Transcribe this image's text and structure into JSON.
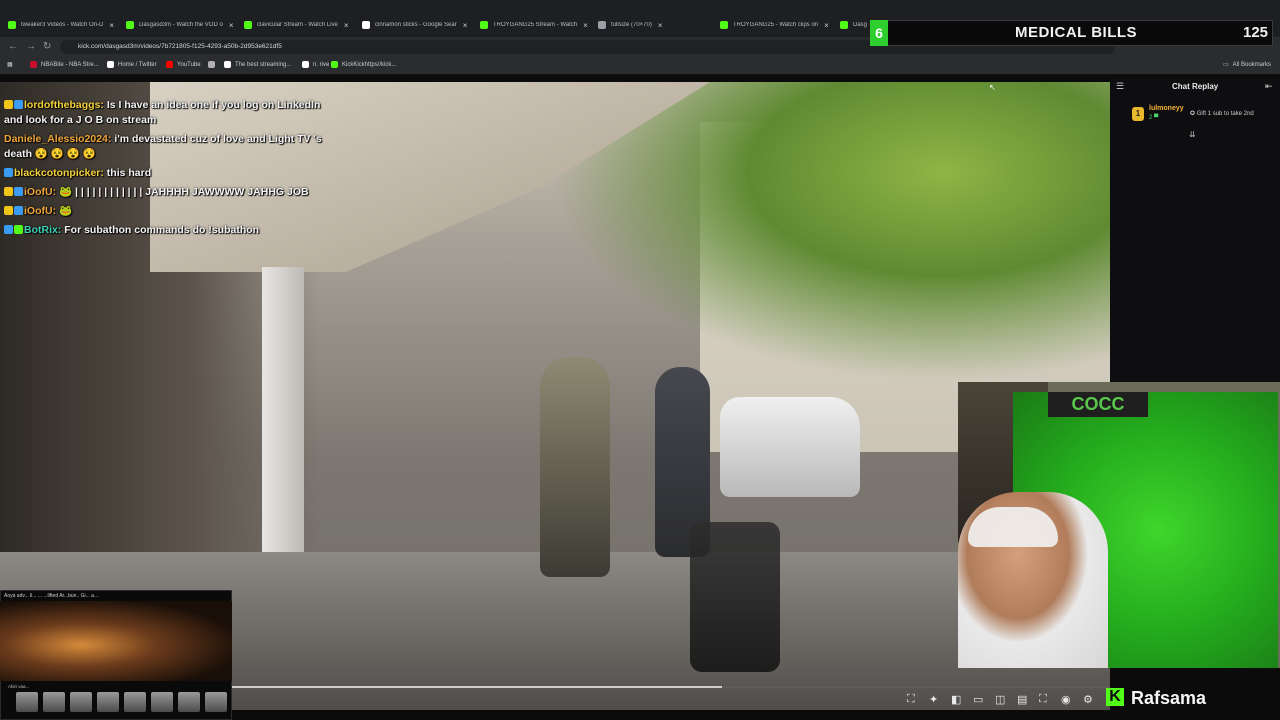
{
  "browser": {
    "tabs": [
      {
        "label": "tweaker3 Videos - Watch On-D",
        "color": "#53fc18"
      },
      {
        "label": "Dasgasd3m - Watch the VOD o",
        "color": "#53fc18"
      },
      {
        "label": "clavicular Stream - Watch Live",
        "color": "#53fc18"
      },
      {
        "label": "cinnamon sticks - Google Sear",
        "color": "#ffffff"
      },
      {
        "label": "TROYGANG25 Stream - Watch",
        "color": "#53fc18"
      },
      {
        "label": "fullsize (70×70)",
        "color": "#9aa0a6"
      },
      {
        "label": "TROYGANG25 - Watch clips on",
        "color": "#53fc18"
      },
      {
        "label": "Dasg",
        "color": "#53fc18"
      }
    ],
    "active_tab_tail": "Watch the V",
    "new_tab": "+",
    "url": "kick.com/dasgasd3m/videos/7b721805-f125-4293-a50b-2d953e621df5",
    "bookmarks": [
      {
        "label": "NBABite - NBA Stre...",
        "color": "#c8102e"
      },
      {
        "label": "Home / Twitter",
        "color": "#ffffff"
      },
      {
        "label": "YouTube",
        "color": "#ff0000"
      },
      {
        "label": "",
        "color": "#b0b0b0"
      },
      {
        "label": "The best streaming...",
        "color": "#ffffff"
      },
      {
        "label": "n. rive",
        "color": "#ffffff"
      },
      {
        "label": "KickKickhttps//kick...",
        "color": "#53fc18"
      }
    ],
    "all_bookmarks": "All Bookmarks"
  },
  "overlay": {
    "goal_number": "6",
    "goal_title": "MEDICAL BILLS",
    "goal_count": "125"
  },
  "chat": [
    {
      "user": "lordofthebaggs",
      "user_color": "#f5d23b",
      "badges": [
        "#f0c419",
        "#3b9cf5"
      ],
      "text": " Is I have an idea one if you log on LinkedIn and look for a J O B on stream"
    },
    {
      "user": "Daniele_Alessio2024",
      "user_color": "#f0a63b",
      "badges": [],
      "text": " i'm devastated cuz of love and Light TV 's death 😵 😵 😵 😵"
    },
    {
      "user": "blackcotonpicker",
      "user_color": "#f5d23b",
      "badges": [
        "#3b9cf5"
      ],
      "text": " this hard"
    },
    {
      "user": "iOofU",
      "user_color": "#f0a63b",
      "badges": [
        "#f0c419",
        "#3b9cf5"
      ],
      "text": " 🐸 | | | | | | | | | | | | JAHHHH JAWWWW JAHHG JOB"
    },
    {
      "user": "iOofU",
      "user_color": "#f0a63b",
      "badges": [
        "#f0c419",
        "#3b9cf5"
      ],
      "text": " 🐸"
    },
    {
      "user": "BotRix",
      "user_color": "#3bd1b4",
      "badges": [
        "#3b9cf5",
        "#53fc18"
      ],
      "text": " For subathon commands do !subathon"
    }
  ],
  "replay": {
    "title": "Chat Replay",
    "badge": "1",
    "user": "lulmoneyy",
    "sub": "2 ▀",
    "gift_text": "Gift 1 sub to take 2nd"
  },
  "player": {
    "progress": 0.65,
    "channel_logo": "K",
    "channel_name": "Rafsama",
    "controls": [
      "crop-icon",
      "sparkle-icon",
      "pip-icon",
      "theater-icon",
      "clip-icon",
      "chat-icon",
      "fullscreen-icon",
      "speed-icon",
      "settings-icon"
    ]
  },
  "webcam": {
    "banner": "COCC"
  },
  "mini": {
    "title": "Aoya adv... li... ... ...lifted Ar...bun.. Gi... a...",
    "caption": "Abiri vaa..."
  }
}
